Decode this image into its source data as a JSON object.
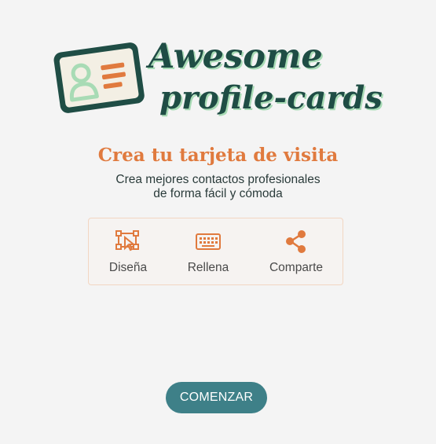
{
  "logo": {
    "line1": "Awesome",
    "line2": "profile-cards"
  },
  "hero": {
    "title": "Crea tu tarjeta de visita",
    "subtitle_line1": "Crea mejores contactos profesionales",
    "subtitle_line2": "de forma fácil y cómoda"
  },
  "features": [
    {
      "icon": "vector-select-icon",
      "label": "Diseña"
    },
    {
      "icon": "keyboard-icon",
      "label": "Rellena"
    },
    {
      "icon": "share-icon",
      "label": "Comparte"
    }
  ],
  "cta": {
    "label": "COMENZAR"
  },
  "colors": {
    "background": "#f4f4f4",
    "accent_orange": "#e07a3e",
    "dark_green": "#1f4d45",
    "mint": "#a8dbb5",
    "button_teal": "#3e8088"
  }
}
